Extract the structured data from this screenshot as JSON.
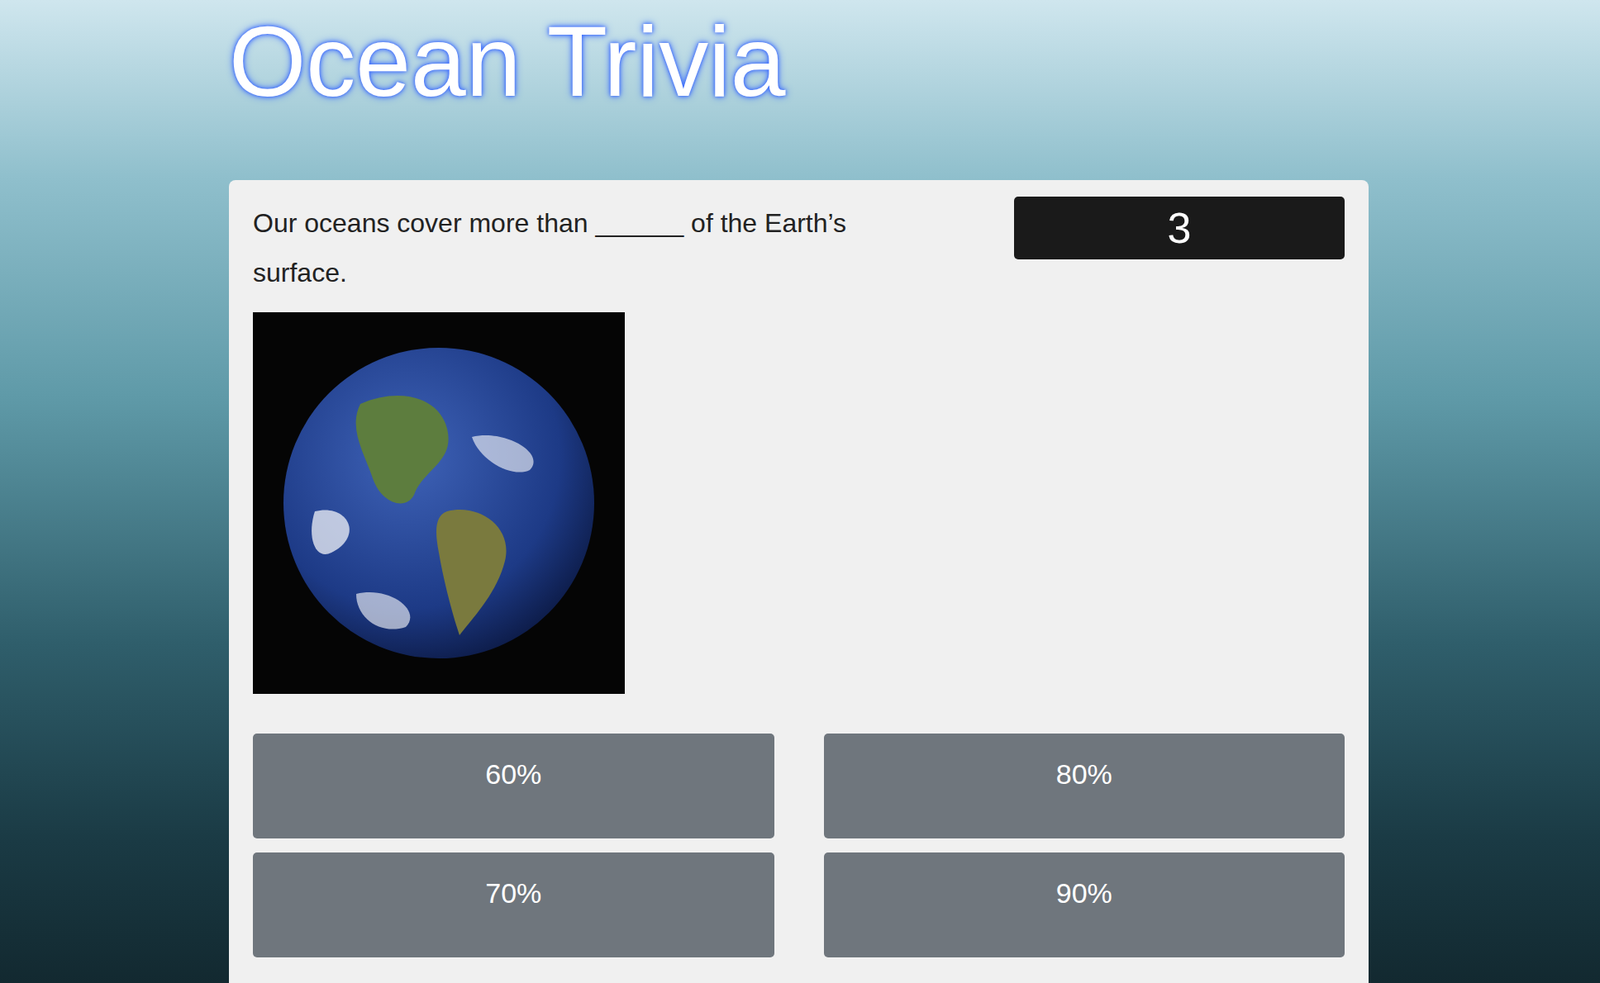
{
  "page": {
    "title": "Ocean Trivia"
  },
  "question": {
    "text": "Our oceans cover more than ______ of the Earth’s surface.",
    "timer": "3"
  },
  "answers": [
    {
      "label": "60%",
      "selected": false
    },
    {
      "label": "80%",
      "selected": false
    },
    {
      "label": "70%",
      "selected": false
    },
    {
      "label": "90%",
      "selected": false
    }
  ]
}
